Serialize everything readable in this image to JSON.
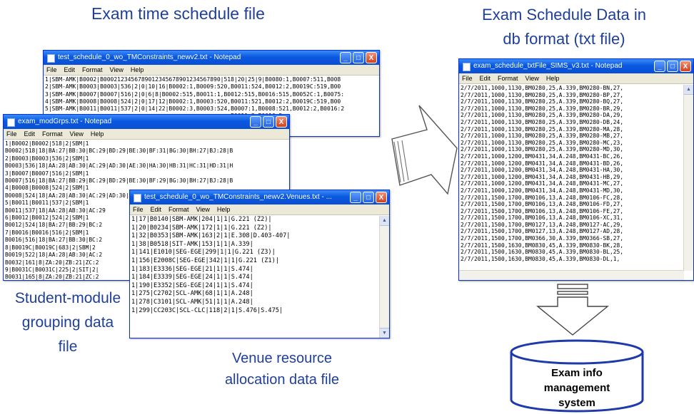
{
  "captions": {
    "exam_time_schedule": "Exam time schedule file",
    "db_format_line1": "Exam Schedule Data in",
    "db_format_line2": "db format (txt file)",
    "student_line1": "Student-module",
    "student_line2": "grouping data",
    "student_line3": "file",
    "venue_line1": "Venue resource",
    "venue_line2": "allocation data file"
  },
  "menu": {
    "file": "File",
    "edit": "Edit",
    "format": "Format",
    "view": "View",
    "help": "Help"
  },
  "window_buttons": {
    "minimize": "_",
    "maximize": "□",
    "close": "X"
  },
  "windows": {
    "schedule": {
      "title": "test_schedule_0_wo_TMConstraints_newv2.txt - Notepad",
      "lines": [
        "1|SBM-AMK|B0002|B0002123456789012345678901234567890|518|20|25|9|B0080:1,B0007:511,B008",
        "2|SBM-AMK|B0003|B0003|536|2|0|10|16|B0002:1,B0009:520,B0011:524,B0012:2,B0019C:519,B00",
        "3|SBM-AMK|B0007|B0007|516|2|0|6|8|B0002:515,B0011:1,B0012:515,B0016:515,B0052C:1,B0075:",
        "4|SBM-AMK|B0008|B0008|524|2|0|17|12|B0002:1,B0003:520,B0011:521,B0012:2,B0019C:519,B00",
        "5|SBM-AMK|B0011|B0011|537|2|0|14|22|B0002:3,B0003:524,B0007:1,B0008:521,B0012:2,B0016:2",
        "                                                     ,B0011:2,B0016:5",
        "                                                     ,B0078:1,B0036",
        "                                                     |319,B0012:1,B001",
        "                                                     C:221,1111C:60,1",
        "                                                     2:3,B0019C:2,B003",
        "                                                     9C,B0234:172,B024C",
        "                                                     078:58,B0140:97,B",
        "                                                     7,B0012:3,B0019C:",
        "                                                     2,B0011:9,B0012:4",
        "                                                     :,B0742:84"
      ]
    },
    "grouping": {
      "title": "exam_modGrps.txt - Notepad",
      "lines": [
        "1|B0002|B0002|518|2|SBM|1",
        "B0002|518|18|BA:27|BB:30|BC:29|BD:29|BE:30|BF:31|BG:30|BH:27|BJ:28|B",
        "2|B0003|B0003|536|2|SBM|1",
        "B0003|536|18|AA:28|AB:30|AC:29|AD:30|AE:30|HA:30|HB:31|HC:31|HD:31|H",
        "3|B0007|B0007|516|2|SBM|1",
        "B0007|516|18|BA:27|BB:29|BC:29|BD:29|BE:30|BF:29|BG:30|BH:27|BJ:28|B",
        "4|B0008|B0008|524|2|SBM|1",
        "B0008|524|18|AA:28|AB:30|AC:29|AD:30|AE:30|HA:30|HB:29|HC:29|HD:29|H",
        "5|B0011|B0011|537|2|SBM|1",
        "B0011|537|18|AA:28|AB:30|AC:29",
        "6|B0012|B0012|524|2|SBM|1",
        "B0012|524|18|BA:27|BB:29|BC:2",
        "7|B0016|B0016|516|2|SBM|1",
        "B0016|516|18|BA:27|BB:30|BC:2",
        "8|B0019C|B0019C|683|2|SBM|2",
        "B0019|522|18|AA:28|AB:30|AC:2",
        "B0032|161|8|ZA:20|ZB:21|ZC:2",
        "9|B0031C|B0031C|225|2|SIT|2|",
        "B0031|165|8|ZA:20|ZB:21|ZC:2",
        "IT1625|60|3|01:20|02:20|03:20"
      ]
    },
    "venues": {
      "title": "test_schedule_0_wo_TMConstraints_newv2.Venues.txt - ...",
      "lines": [
        "1|17|B0140|SBM-AMK|204|1|1|G.221 (Z2)|",
        "1|20|B0234|SBM-AMK|172|1|1|G.221 (Z2)|",
        "1|32|B0353|SBM-AMK|163|2|1|E.308|D.403-407|",
        "1|38|B0518|SIT-AMK|153|1|1|A.339|",
        "1|141|E1010|SEG-EGE|299|1|1|G.221 (Z3)|",
        "1|156|E2008C|SEG-EGE|342|1|1|G.221 (Z1)|",
        "1|183|E3336|SEG-EGE|21|1|1|S.474|",
        "1|184|E3339|SEG-EGE|24|1|1|S.474|",
        "1|190|E3352|SEG-EGE|24|1|1|S.474|",
        "1|275|C2702|SCL-AMK|68|1|1|A.248|",
        "1|278|C3101|SCL-AMK|51|1|1|A.248|",
        "1|299|CC203C|SCL-CLC|118|2|1|S.476|S.475|"
      ]
    },
    "dbformat": {
      "title": "exam_schedule_txtFile_SIMS_v3.txt - Notepad",
      "lines": [
        "2/7/2011,1000,1130,BM0280,25,A.339,BM0280-BN,27,",
        "2/7/2011,1000,1130,BM0280,25,A.339,BM0280-BP,27,",
        "2/7/2011,1000,1130,BM0280,25,A.339,BM0280-BQ,27,",
        "2/7/2011,1000,1130,BM0280,25,A.339,BM0280-BR,29,",
        "2/7/2011,1000,1130,BM0280,25,A.339,BM0280-DA,29,",
        "2/7/2011,1000,1130,BM0280,25,A.339,BM0280-DB,24,",
        "2/7/2011,1000,1130,BM0280,25,A.339,BM0280-MA,28,",
        "2/7/2011,1000,1130,BM0280,25,A.339,BM0280-MB,27,",
        "2/7/2011,1000,1130,BM0280,25,A.339,BM0280-MC,23,",
        "2/7/2011,1000,1130,BM0280,25,A.339,BM0280-MD,30,",
        "2/7/2011,1000,1200,BM0431,34,A.248,BM0431-BC,26,",
        "2/7/2011,1000,1200,BM0431,34,A.248,BM0431-BD,26,",
        "2/7/2011,1000,1200,BM0431,34,A.248,BM0431-HA,30,",
        "2/7/2011,1000,1200,BM0431,34,A.248,BM0431-HB,29,",
        "2/7/2011,1000,1200,BM0431,34,A.248,BM0431-MC,27,",
        "2/7/2011,1000,1200,BM0431,34,A.248,BM0431-MD,30,",
        "2/7/2011,1500,1700,BM0106,13,A.248,BM0106-FC,28,",
        "2/7/2011,1500,1700,BM0106,13,A.248,BM0106-FD,27,",
        "2/7/2011,1500,1700,BM0106,13,A.248,BM0106-FE,27,",
        "2/7/2011,1500,1700,BM0106,13,A.248,BM0106-XC,31,",
        "2/7/2011,1500,1700,BM0127,13,A.248,BM0127-AC,29,",
        "2/7/2011,1500,1700,BM0127,13,A.248,BM0127-AD,28,",
        "2/7/2011,1500,1700,BM0366,30,A.339,BM0366-SB,27,",
        "2/7/2011,1500,1630,BM0830,45,A.339,BM0830-BK,28,",
        "2/7/2011,1500,1630,BM0830,45,A.339,BM0830-BL,25,",
        "2/7/2011,1500,1630,BM0830,45,A.339,BM0830-DL,1,"
      ]
    }
  },
  "database": {
    "line1": "Exam info",
    "line2": "management",
    "line3": "system"
  },
  "colors": {
    "caption": "#1f3f9a",
    "titlebar": "#0a58e0"
  }
}
